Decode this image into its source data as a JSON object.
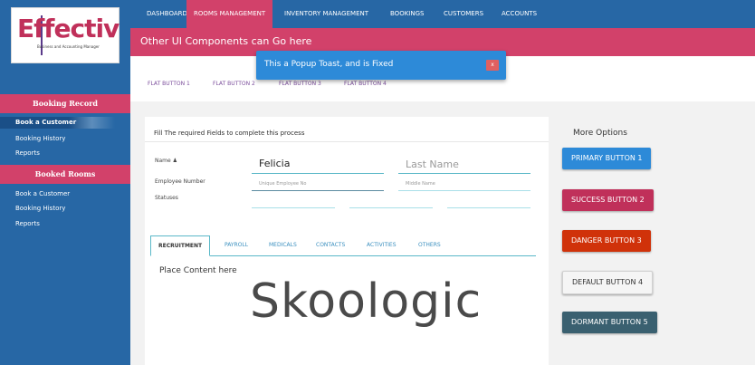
{
  "logo": {
    "word": "Effectiv",
    "tagline": "Business and Accounting Manager"
  },
  "nav": {
    "items": [
      "DASHBOARD",
      "ROOMS MANAGEMENT",
      "INVENTORY MANAGEMENT",
      "BOOKINGS",
      "CUSTOMERS",
      "ACCOUNTS"
    ],
    "active_index": 1
  },
  "banner": {
    "text": "Other UI Components can Go here"
  },
  "flat_buttons": [
    "FLAT BUTTON 1",
    "FLAT BUTTON 2",
    "FLAT BUTTON 3",
    "FLAT BUTTON 4"
  ],
  "toast": {
    "text": "This a Popup Toast, and is Fixed",
    "close": "x"
  },
  "sidebar": {
    "section1": {
      "title": "Booking Record",
      "items": [
        "Book a Customer",
        "Booking History",
        "Reports"
      ]
    },
    "section2": {
      "title": "Booked Rooms",
      "items": [
        "Book a Customer",
        "Booking History",
        "Reports"
      ]
    }
  },
  "form": {
    "title": "Fill The required Fields to complete this process",
    "name_label": "Name",
    "first_name": "Felicia",
    "last_name_placeholder": "Last Name",
    "employee_label": "Employee Number",
    "employee_placeholder": "Unique Employee No",
    "middle_placeholder": "Middle Name",
    "statuses_label": "Statuses"
  },
  "tabs": {
    "items": [
      "RECRUITMENT",
      "PAYROLL",
      "MEDICALS",
      "CONTACTS",
      "ACTIVITIES",
      "OTHERS"
    ],
    "active_index": 0
  },
  "content": {
    "text": "Place Content here"
  },
  "watermark": "Skoologic",
  "options": {
    "title": "More Options",
    "buttons": [
      {
        "label": "PRIMARY BUTTON 1",
        "color": "#2d8ad8"
      },
      {
        "label": "SUCCESS BUTTON 2",
        "color": "#c0305a"
      },
      {
        "label": "DANGER BUTTON 3",
        "color": "#d0320a"
      },
      {
        "label": "DEFAULT BUTTON 4",
        "color": "#f5f5f5"
      },
      {
        "label": "DORMANT BUTTON 5",
        "color": "#3a6070"
      }
    ]
  },
  "colors": {
    "primary": "#2767a5",
    "accent": "#d2416a",
    "toast": "#2d8ad8"
  }
}
